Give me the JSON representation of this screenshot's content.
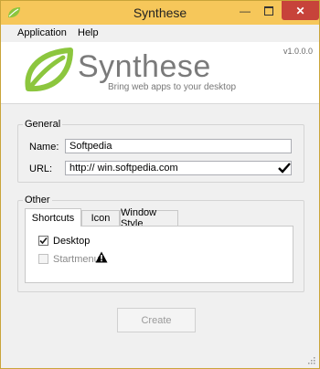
{
  "window": {
    "title": "Synthese"
  },
  "menu": {
    "items": [
      "Application",
      "Help"
    ]
  },
  "banner": {
    "logo_text": "Synthese",
    "tagline": "Bring web apps to your desktop",
    "version": "v1.0.0.0"
  },
  "general": {
    "legend": "General",
    "name_label": "Name:",
    "name_value": "Softpedia",
    "url_label": "URL:",
    "url_value": "http:// win.softpedia.com"
  },
  "other": {
    "legend": "Other",
    "tabs": [
      "Shortcuts",
      "Icon",
      "Window Style"
    ],
    "active_tab": "Shortcuts",
    "shortcuts": [
      {
        "label": "Desktop",
        "checked": true,
        "enabled": true
      },
      {
        "label": "Startmenu",
        "checked": false,
        "enabled": false
      }
    ]
  },
  "actions": {
    "create_label": "Create"
  },
  "colors": {
    "titlebar": "#f6c75a",
    "close": "#c7433a",
    "leaf": "#8cc63e"
  }
}
